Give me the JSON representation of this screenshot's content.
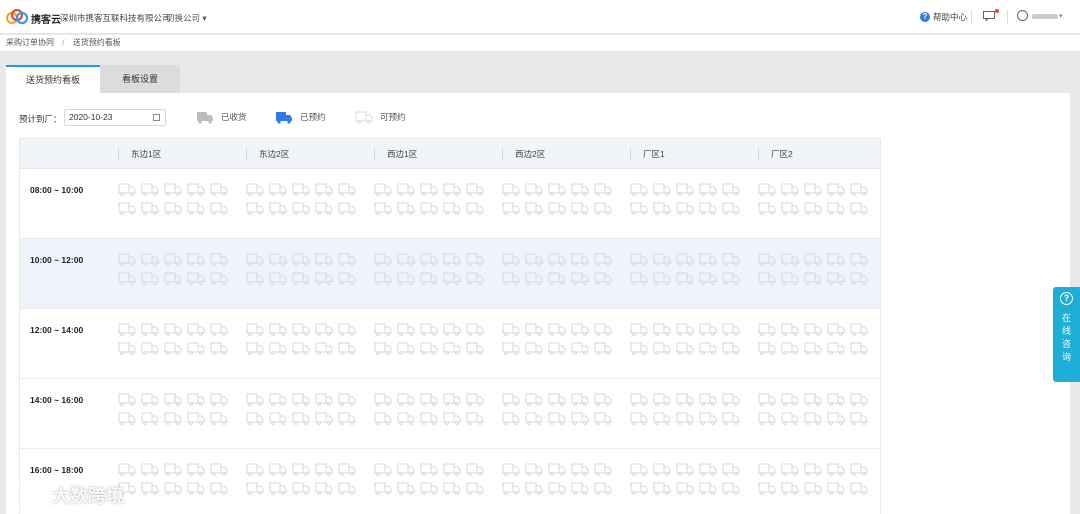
{
  "header": {
    "logo_text": "携客云",
    "company": "深圳市携客互联科技有限公司",
    "switch_label": "切换公司",
    "help_label": "帮助中心"
  },
  "breadcrumb": [
    "采购订单协同",
    "送货预约看板"
  ],
  "tabs": [
    {
      "label": "送货预约看板",
      "active": true
    },
    {
      "label": "看板设置",
      "active": false
    }
  ],
  "filter": {
    "label": "预计到厂：",
    "date": "2020-10-23"
  },
  "legend": [
    {
      "label": "已收货",
      "color": "#b9bdc2"
    },
    {
      "label": "已预约",
      "color": "#2f7be8"
    },
    {
      "label": "可预约",
      "color": "#d7dadd"
    }
  ],
  "zones": [
    "东边1区",
    "东边2区",
    "西边1区",
    "西边2区",
    "厂区1",
    "厂区2"
  ],
  "slots": [
    {
      "label": "08:00 ~ 10:00",
      "highlight": false
    },
    {
      "label": "10:00 ~ 12:00",
      "highlight": true
    },
    {
      "label": "12:00 ~ 14:00",
      "highlight": false
    },
    {
      "label": "14:00 ~ 16:00",
      "highlight": false
    },
    {
      "label": "16:00 ~ 18:00",
      "highlight": false
    }
  ],
  "trucks_per_zone": 10,
  "consult": {
    "text": "在线咨询"
  },
  "watermark": "大数跨境"
}
